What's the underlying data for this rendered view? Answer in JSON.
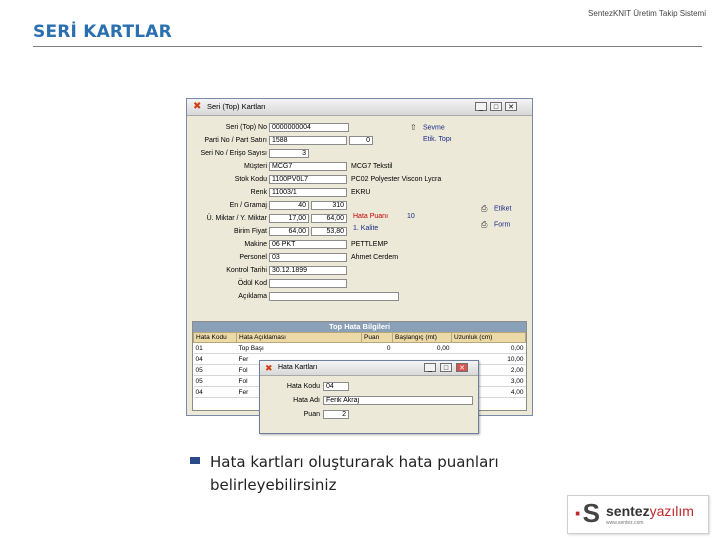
{
  "slide": {
    "title": "SERİ KARTLAR",
    "header_right": "SentezKNIT Üretim Takip Sistemi",
    "bullet_text": "Hata kartları oluşturarak hata puanları belirleyebilirsiniz"
  },
  "window": {
    "title": "Seri (Top) Kartları",
    "fields": [
      {
        "label": "Seri (Top) No",
        "value": "0000000004"
      },
      {
        "label": "Parti No / Part Satırı",
        "value": "1588",
        "value2": "0"
      },
      {
        "label": "Seri No / Erişo Sayısı",
        "value": "3"
      },
      {
        "label": "Müşteri",
        "value": "MCG7",
        "text": "MCG7 Tekstil"
      },
      {
        "label": "Stok Kodu",
        "value": "1100PV0L7",
        "text": "PC02 Polyester Viscon Lycra"
      },
      {
        "label": "Renk",
        "value": "11003/1",
        "text": "EKRU"
      },
      {
        "label": "En / Gramaj",
        "value": "40",
        "value2": "310"
      },
      {
        "label": "Ü. Miktar / Y. Miktar",
        "value": "17,00",
        "value2": "64,00"
      },
      {
        "label": "Birim Fiyat",
        "value": "64,00",
        "value2": "53,80"
      },
      {
        "label": "Makine",
        "value": "06 PKT",
        "text": "PETTLEMP"
      },
      {
        "label": "Personel",
        "value": "03",
        "text": "Ahmet Cerdem"
      },
      {
        "label": "Kontrol Tarihi",
        "value": "30.12.1899"
      },
      {
        "label": "Ödül Kod",
        "value": ""
      },
      {
        "label": "Açıklama",
        "value": ""
      }
    ],
    "hata_puani_label": "Hata Puanı",
    "hata_puani_value": "10",
    "kalite_label": "1. Kalite",
    "actions": {
      "sevme": "Sevme",
      "etiket_top": "Etik. Topı",
      "etiket": "Etiket",
      "form": "Form"
    },
    "grid": {
      "title": "Top Hata Bilgileri",
      "columns": [
        "Hata Kodu",
        "Hata Açıklaması",
        "Puan",
        "Başlangıç (mt)",
        "Uzunluk (cm)"
      ],
      "rows": [
        {
          "kod": "01",
          "aciklama": "Top Başı",
          "puan": "0",
          "baslangic": "0,00",
          "uzunluk": "0,00"
        },
        {
          "kod": "04",
          "aciklama": "Fer",
          "puan": "",
          "baslangic": "",
          "uzunluk": "10,00"
        },
        {
          "kod": "05",
          "aciklama": "Fol",
          "puan": "",
          "baslangic": "",
          "uzunluk": "2,00"
        },
        {
          "kod": "05",
          "aciklama": "Fol",
          "puan": "",
          "baslangic": "",
          "uzunluk": "3,00"
        },
        {
          "kod": "04",
          "aciklama": "Fer",
          "puan": "",
          "baslangic": "",
          "uzunluk": "4,00"
        }
      ]
    }
  },
  "popup": {
    "title": "Hata Kartları",
    "fields": [
      {
        "label": "Hata Kodu",
        "value": "04"
      },
      {
        "label": "Hata Adı",
        "value": "Ferik Akraj"
      },
      {
        "label": "Puan",
        "value": "2"
      }
    ]
  },
  "logo": {
    "brand_a": "sentez",
    "brand_b": "yazılım",
    "url": "www.sentez.com"
  }
}
